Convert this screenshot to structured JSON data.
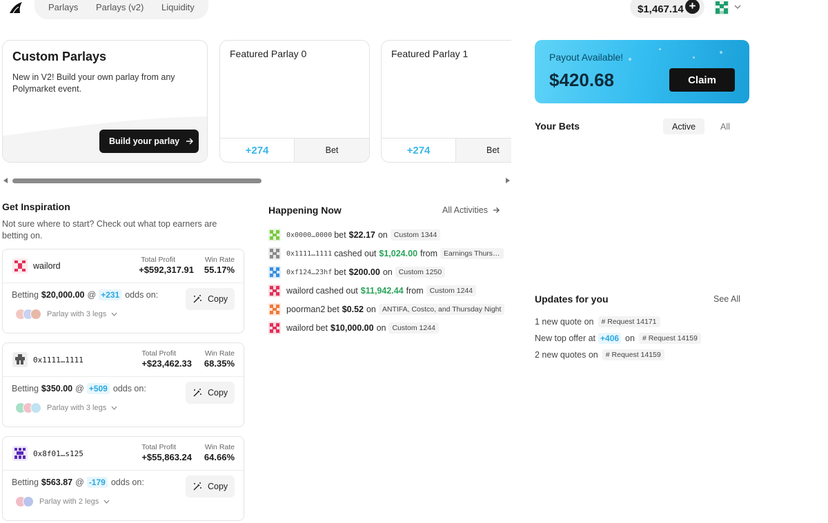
{
  "nav": {
    "items": [
      "Parlays",
      "Parlays (v2)",
      "Liquidity"
    ]
  },
  "header": {
    "balance": "$1,467.14",
    "add_icon": "plus-circle-icon",
    "avatar_icon": "pixel-avatar-icon",
    "chevron_icon": "chevron-down-icon"
  },
  "custom_parlays": {
    "title": "Custom Parlays",
    "description": "New in V2! Build your own parlay from any Polymarket event.",
    "button_label": "Build your parlay",
    "button_icon": "arrow-right-icon"
  },
  "featured": [
    {
      "title": "Featured Parlay 0",
      "odds": "+274",
      "bet_label": "Bet"
    },
    {
      "title": "Featured Parlay 1",
      "odds": "+274",
      "bet_label": "Bet"
    }
  ],
  "inspiration": {
    "title": "Get Inspiration",
    "description": "Not sure where to start? Check out what top earners are betting on.",
    "total_profit_label": "Total Profit",
    "win_rate_label": "Win Rate",
    "betting_label": "Betting",
    "at_symbol": "@",
    "odds_on_label": "odds on:",
    "copy_label": "Copy",
    "cards": [
      {
        "user": "wailord",
        "profit": "+$592,317.91",
        "win_rate": "55.17%",
        "amount": "$20,000.00",
        "odds": "+231",
        "legs": "Parlay with 3 legs",
        "leg_colors": [
          "#f2c7c2",
          "#c9d2f0",
          "#e8b8a8"
        ]
      },
      {
        "user": "0x1111…1111",
        "profit": "+$23,462.33",
        "win_rate": "68.35%",
        "amount": "$350.00",
        "odds": "+509",
        "legs": "Parlay with 3 legs",
        "leg_colors": [
          "#a8e0c8",
          "#f3c1c8",
          "#bfe3f3"
        ]
      },
      {
        "user": "0x8f01…s125",
        "profit": "+$55,863.24",
        "win_rate": "64.66%",
        "amount": "$563.87",
        "odds": "-179",
        "legs": "Parlay with 2 legs",
        "leg_colors": [
          "#f2bdc8",
          "#b8c4ec"
        ]
      }
    ]
  },
  "happening": {
    "title": "Happening Now",
    "all_activities": "All Activities",
    "items": [
      {
        "who": "0x0000…0000",
        "mono": true,
        "action": "bet",
        "amount": "$22.17",
        "green": false,
        "prep": "on",
        "tag": "Custom 1344",
        "color": "#7ac943"
      },
      {
        "who": "0x1111…1111",
        "mono": true,
        "action": "cashed out",
        "amount": "$1,024.00",
        "green": true,
        "prep": "from",
        "tag": "Earnings Thursday",
        "color": "#8a8a8a"
      },
      {
        "who": "0xf124…23hf",
        "mono": true,
        "action": "bet",
        "amount": "$200.00",
        "green": false,
        "prep": "on",
        "tag": "Custom 1250",
        "color": "#3a8fe0"
      },
      {
        "who": "wailord",
        "mono": false,
        "action": "cashed out",
        "amount": "$11,942.44",
        "green": true,
        "prep": "from",
        "tag": "Custom 1244",
        "color": "#e0315a"
      },
      {
        "who": "poorman2",
        "mono": false,
        "action": "bet",
        "amount": "$0.52",
        "green": false,
        "prep": "on",
        "tag": "ANTIFA, Costco, and Thursday Night",
        "color": "#f07a3a"
      },
      {
        "who": "wailord",
        "mono": false,
        "action": "bet",
        "amount": "$10,000.00",
        "green": false,
        "prep": "on",
        "tag": "Custom 1244",
        "color": "#e0315a"
      }
    ]
  },
  "payout": {
    "label": "Payout Available!",
    "amount": "$420.68",
    "claim_label": "Claim"
  },
  "your_bets": {
    "title": "Your Bets",
    "tabs": [
      "Active",
      "All"
    ]
  },
  "updates": {
    "title": "Updates for you",
    "see_all": "See All",
    "items": [
      {
        "text": "1 new quote on",
        "odds": "",
        "suffix": "",
        "request": "Request 14171"
      },
      {
        "text": "New top offer at",
        "odds": "+406",
        "suffix": "on",
        "request": "Request 14159"
      },
      {
        "text": "2 new quotes on",
        "odds": "",
        "suffix": "",
        "request": "Request 14159"
      }
    ]
  }
}
